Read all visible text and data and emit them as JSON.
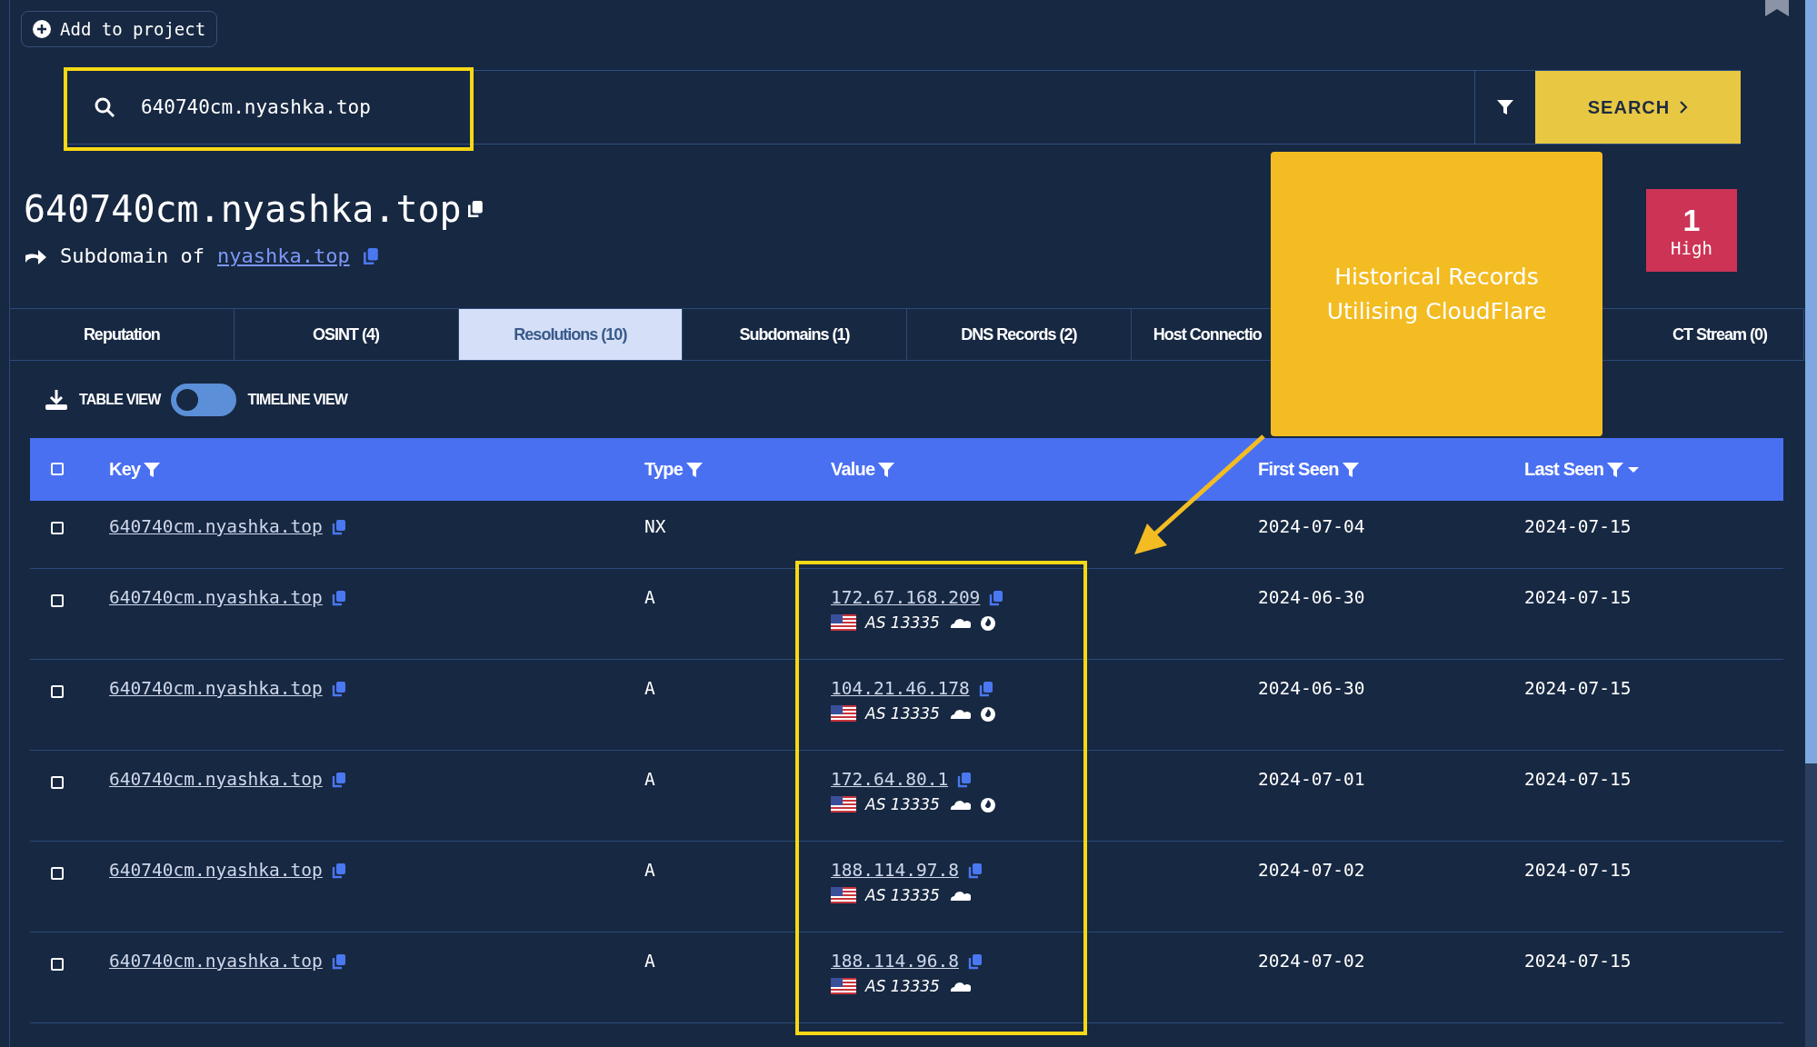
{
  "add_button": {
    "label": "Add to project"
  },
  "search": {
    "value": "640740cm.nyashka.top",
    "button": "SEARCH"
  },
  "domain": {
    "title": "640740cm.nyashka.top",
    "subdomain_label": "Subdomain of",
    "parent": "nyashka.top"
  },
  "risk_badge": {
    "count": "1",
    "level": "High"
  },
  "tabs": [
    {
      "label": "Reputation",
      "selected": false
    },
    {
      "label": "OSINT (4)",
      "selected": false
    },
    {
      "label": "Resolutions (10)",
      "selected": true
    },
    {
      "label": "Subdomains (1)",
      "selected": false
    },
    {
      "label": "DNS Records (2)",
      "selected": false
    },
    {
      "label": "Host Connectio",
      "selected": false
    },
    {
      "label": "CT Stream (0)",
      "selected": false
    }
  ],
  "view_toggle": {
    "left_label": "TABLE VIEW",
    "right_label": "TIMELINE VIEW",
    "timeline": false
  },
  "table": {
    "select_all_checked": false,
    "columns": [
      "Key",
      "Type",
      "Value",
      "First Seen",
      "Last Seen"
    ],
    "rows": [
      {
        "checked": false,
        "key": "640740cm.nyashka.top",
        "type": "NX",
        "first_seen": "2024-07-04",
        "last_seen": "2024-07-15"
      },
      {
        "checked": false,
        "key": "640740cm.nyashka.top",
        "type": "A",
        "value": "172.67.168.209",
        "asn": "AS 13335",
        "cloudflare": true,
        "flame": true,
        "first_seen": "2024-06-30",
        "last_seen": "2024-07-15"
      },
      {
        "checked": false,
        "key": "640740cm.nyashka.top",
        "type": "A",
        "value": "104.21.46.178",
        "asn": "AS 13335",
        "cloudflare": true,
        "flame": true,
        "first_seen": "2024-06-30",
        "last_seen": "2024-07-15"
      },
      {
        "checked": false,
        "key": "640740cm.nyashka.top",
        "type": "A",
        "value": "172.64.80.1",
        "asn": "AS 13335",
        "cloudflare": true,
        "flame": true,
        "first_seen": "2024-07-01",
        "last_seen": "2024-07-15"
      },
      {
        "checked": false,
        "key": "640740cm.nyashka.top",
        "type": "A",
        "value": "188.114.97.8",
        "asn": "AS 13335",
        "cloudflare": true,
        "flame": false,
        "first_seen": "2024-07-02",
        "last_seen": "2024-07-15"
      },
      {
        "checked": false,
        "key": "640740cm.nyashka.top",
        "type": "A",
        "value": "188.114.96.8",
        "asn": "AS 13335",
        "cloudflare": true,
        "flame": false,
        "first_seen": "2024-07-02",
        "last_seen": "2024-07-15"
      }
    ]
  },
  "annotation": {
    "text": "Historical Records Utilising CloudFlare"
  }
}
